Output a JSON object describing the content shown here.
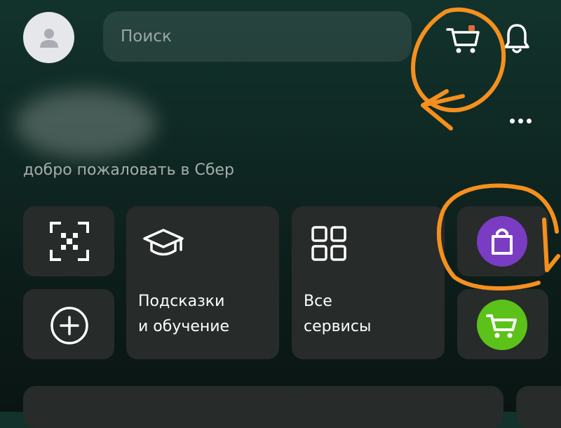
{
  "header": {
    "search_placeholder": "Поиск"
  },
  "greeting": {
    "welcome_text": "добро пожаловать в Сбер"
  },
  "tiles": {
    "tips_line1": "Подсказки",
    "tips_line2": "и обучение",
    "services_line1": "Все",
    "services_line2": "сервисы"
  },
  "colors": {
    "annotation_orange": "#f5901e",
    "shop_purple": "#7b3cc4",
    "market_green": "#5cc21a"
  },
  "icons": [
    "user-icon",
    "cart-icon",
    "bell-icon",
    "more-icon",
    "qr-scan-icon",
    "plus-icon",
    "graduation-cap-icon",
    "grid-icon",
    "shopping-bag-icon",
    "market-cart-icon"
  ]
}
